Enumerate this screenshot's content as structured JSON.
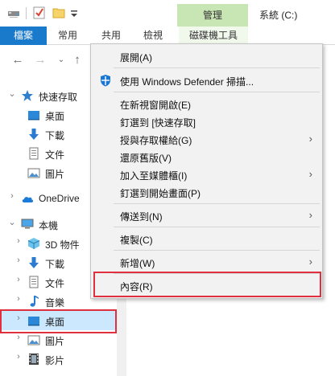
{
  "titlebar": {
    "manage_tab": "管理",
    "window_title": "系統 (C:)"
  },
  "ribbon": {
    "tabs": [
      "檔案",
      "常用",
      "共用",
      "檢視"
    ],
    "manage_subtab": "磁碟機工具"
  },
  "sidebar": {
    "items": [
      {
        "label": "快速存取",
        "icon": "star-icon"
      },
      {
        "label": "桌面",
        "icon": "desktop-folder-icon"
      },
      {
        "label": "下載",
        "icon": "download-icon"
      },
      {
        "label": "文件",
        "icon": "document-icon"
      },
      {
        "label": "圖片",
        "icon": "picture-icon"
      },
      {
        "label": "OneDrive",
        "icon": "cloud-icon"
      },
      {
        "label": "本機",
        "icon": "computer-icon"
      },
      {
        "label": "3D 物件",
        "icon": "3d-objects-icon"
      },
      {
        "label": "下載",
        "icon": "download-icon"
      },
      {
        "label": "文件",
        "icon": "document-icon"
      },
      {
        "label": "音樂",
        "icon": "music-icon"
      },
      {
        "label": "桌面",
        "icon": "desktop-folder-icon"
      },
      {
        "label": "圖片",
        "icon": "picture-icon"
      },
      {
        "label": "影片",
        "icon": "video-icon"
      }
    ]
  },
  "context_menu": {
    "items": [
      {
        "label": "展開(A)",
        "bold": true
      },
      {
        "label": "使用 Windows Defender 掃描..."
      },
      {
        "label": "在新視窗開啟(E)"
      },
      {
        "label": "釘選到 [快速存取]"
      },
      {
        "label": "授與存取權給(G)",
        "submenu": true
      },
      {
        "label": "還原舊版(V)"
      },
      {
        "label": "加入至媒體櫃(I)",
        "submenu": true
      },
      {
        "label": "釘選到開始畫面(P)"
      },
      {
        "label": "傳送到(N)",
        "submenu": true
      },
      {
        "label": "複製(C)"
      },
      {
        "label": "新增(W)",
        "submenu": true
      },
      {
        "label": "內容(R)"
      }
    ]
  },
  "colors": {
    "accent": "#1979ca",
    "manage_tab": "#c8e6b4",
    "selection": "#cce8ff",
    "highlight_box": "#e03040"
  }
}
